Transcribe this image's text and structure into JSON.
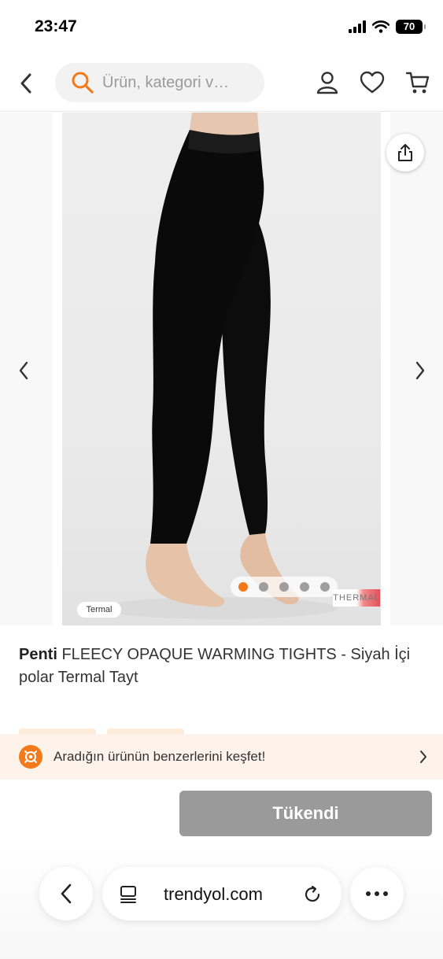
{
  "status_bar": {
    "time": "23:47",
    "battery": "70"
  },
  "header": {
    "back_icon": "chevron-left-icon",
    "search_placeholder": "Ürün, kategori v…",
    "icons": [
      "user-icon",
      "heart-icon",
      "cart-icon"
    ]
  },
  "gallery": {
    "share_icon": "share-icon",
    "image_count": 5,
    "active_index": 0,
    "badge_left": "Termal",
    "badge_right": "THERMAL"
  },
  "product": {
    "brand": "Penti",
    "name": " FLEECY OPAQUE WARMING TIGHTS - Siyah İçi polar Termal Tayt"
  },
  "discover": {
    "text": "Aradığın ürünün benzerlerini keşfet!"
  },
  "buy": {
    "label": "Tükendi"
  },
  "browser": {
    "url": "trendyol.com"
  },
  "colors": {
    "accent": "#f27a1a",
    "discover_bg": "#fef3ea",
    "disabled_button": "#9a9a9a"
  }
}
